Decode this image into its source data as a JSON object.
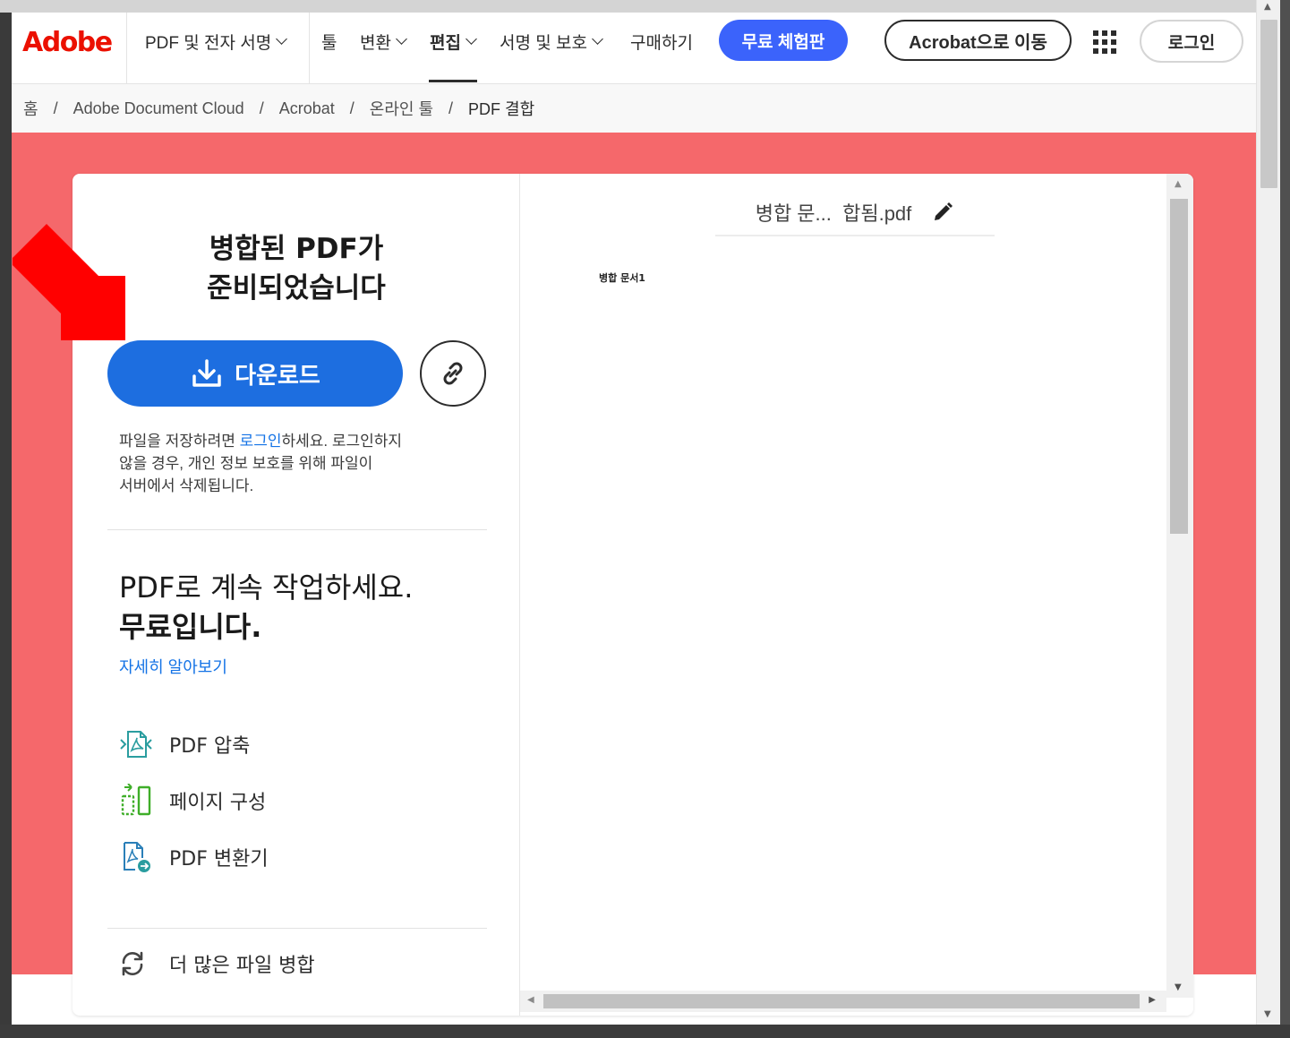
{
  "nav": {
    "logo_text": "Adobe",
    "items": [
      {
        "label": "PDF 및 전자 서명",
        "has_chevron": true
      },
      {
        "label": "툴",
        "has_chevron": false
      },
      {
        "label": "변환",
        "has_chevron": true
      },
      {
        "label": "편집",
        "has_chevron": true,
        "active": true
      },
      {
        "label": "서명 및 보호",
        "has_chevron": true
      },
      {
        "label": "구매하기",
        "has_chevron": false
      }
    ],
    "trial_button": "무료 체험판",
    "acrobat_button": "Acrobat으로 이동",
    "apps_icon": "apps-grid-icon",
    "login_button": "로그인"
  },
  "breadcrumb": [
    "홈",
    "Adobe Document Cloud",
    "Acrobat",
    "온라인 툴",
    "PDF 결합"
  ],
  "breadcrumb_separator": "/",
  "result": {
    "title_line1": "병합된 PDF가",
    "title_line2": "준비되었습니다",
    "download_button": "다운로드",
    "download_icon": "download-icon",
    "link_icon": "link-icon",
    "info_before": "파일을 저장하려면 ",
    "info_link": "로그인",
    "info_after_line1": "하세요. 로그인하지",
    "info_line2": "않을 경우, 개인 정보 보호를 위해 파일이",
    "info_line3": "서버에서 삭제됩니다."
  },
  "continue": {
    "line1": "PDF로 계속 작업하세요.",
    "line2": "무료입니다.",
    "learn_more": "자세히 알아보기",
    "tools": [
      {
        "label": "PDF 압축",
        "icon": "compress-pdf-icon"
      },
      {
        "label": "페이지 구성",
        "icon": "organize-pages-icon"
      },
      {
        "label": "PDF 변환기",
        "icon": "convert-pdf-icon"
      }
    ],
    "merge_more": "더 많은 파일 병합",
    "merge_more_icon": "refresh-icon"
  },
  "preview": {
    "filename": "병합 문...  합됨.pdf",
    "edit_icon": "pencil-icon",
    "doc_text": "병합 문서1"
  },
  "colors": {
    "adobe_red": "#eb1000",
    "hero_bg": "#f5686b",
    "trial_blue": "#3b63fb",
    "download_blue": "#1d6ee0",
    "link_blue": "#1473e6",
    "tool_teal": "#2a9d9f",
    "tool_green": "#3fae29",
    "arrow_red": "#ff0000"
  }
}
